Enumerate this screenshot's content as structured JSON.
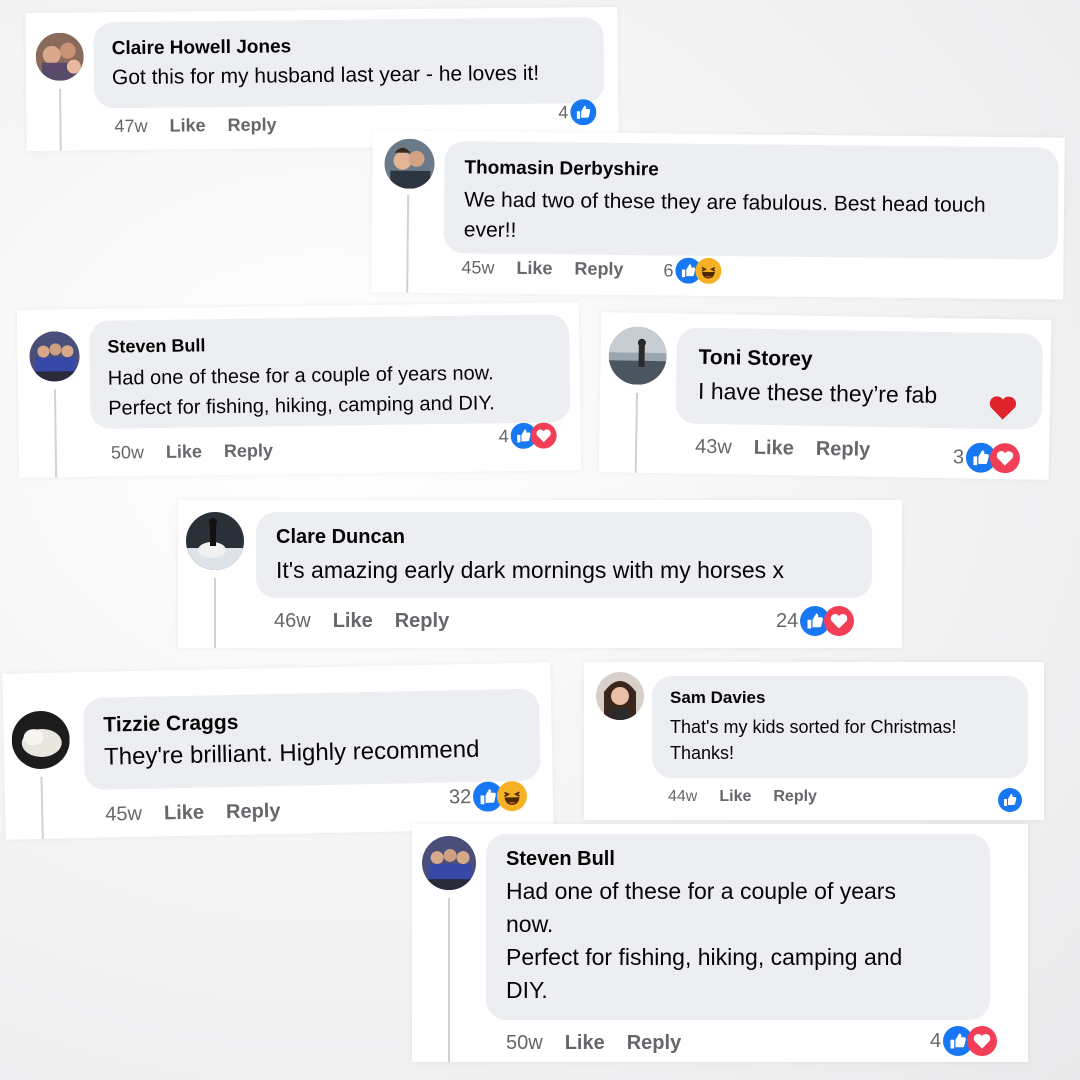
{
  "colors": {
    "like_blue": "#1877f2",
    "love_red": "#f33e58",
    "haha_yellow": "#f7b125",
    "bubble_bg": "#eceef1",
    "meta_gray": "#65676b"
  },
  "comments": [
    {
      "name": "Claire Howell Jones",
      "text": "Got this for my husband last year - he loves it!",
      "time": "47w",
      "like": "Like",
      "reply": "Reply",
      "reaction_count": "4",
      "reactions": [
        "like-icon"
      ]
    },
    {
      "name": "Thomasin Derbyshire",
      "text": "We had two of these they are fabulous. Best head touch ever!!",
      "time": "45w",
      "like": "Like",
      "reply": "Reply",
      "reaction_count": "6",
      "reactions": [
        "like-icon",
        "haha-icon"
      ]
    },
    {
      "name": "Steven Bull",
      "text": "Had one of these for a couple of years now.\nPerfect for fishing, hiking, camping and DIY.",
      "time": "50w",
      "like": "Like",
      "reply": "Reply",
      "reaction_count": "4",
      "reactions": [
        "like-icon",
        "love-icon"
      ]
    },
    {
      "name": "Toni Storey",
      "text": "I have these they’re fab",
      "time": "43w",
      "like": "Like",
      "reply": "Reply",
      "reaction_count": "3",
      "reactions": [
        "like-icon",
        "love-icon"
      ],
      "inline_emoji": "heart-emoji-icon"
    },
    {
      "name": "Clare Duncan",
      "text": "It's amazing early dark mornings with my horses x",
      "time": "46w",
      "like": "Like",
      "reply": "Reply",
      "reaction_count": "24",
      "reactions": [
        "like-icon",
        "love-icon"
      ]
    },
    {
      "name": "Tizzie Craggs",
      "text": "They're brilliant. Highly recommend",
      "time": "45w",
      "like": "Like",
      "reply": "Reply",
      "reaction_count": "32",
      "reactions": [
        "like-icon",
        "haha-icon"
      ]
    },
    {
      "name": "Sam Davies",
      "text": "That's my kids sorted for Christmas!\nThanks!",
      "time": "44w",
      "like": "Like",
      "reply": "Reply",
      "reaction_count": "",
      "reactions": [
        "like-icon"
      ]
    },
    {
      "name": "Steven Bull",
      "text": "Had one of these for a couple of years\nnow.\nPerfect for fishing, hiking, camping and\nDIY.",
      "time": "50w",
      "like": "Like",
      "reply": "Reply",
      "reaction_count": "4",
      "reactions": [
        "like-icon",
        "love-icon"
      ]
    }
  ]
}
